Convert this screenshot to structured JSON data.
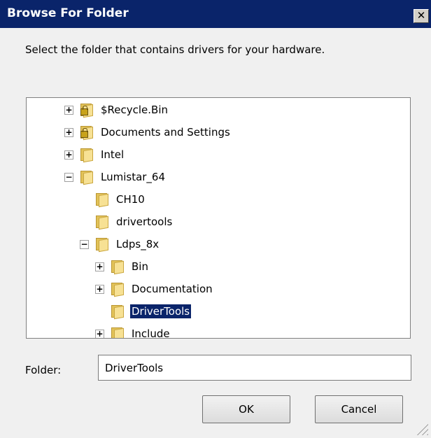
{
  "window": {
    "title": "Browse For Folder",
    "close_glyph": "✕"
  },
  "instruction": "Select the folder that contains drivers for your hardware.",
  "tree": {
    "items": [
      {
        "label": "$Recycle.Bin",
        "level": 0,
        "expander": "+",
        "icon": "locked-folder-icon"
      },
      {
        "label": "Documents and Settings",
        "level": 0,
        "expander": "+",
        "icon": "locked-folder-icon"
      },
      {
        "label": "Intel",
        "level": 0,
        "expander": "+",
        "icon": "folder-icon"
      },
      {
        "label": "Lumistar_64",
        "level": 0,
        "expander": "−",
        "icon": "folder-icon"
      },
      {
        "label": "CH10",
        "level": 1,
        "expander": "",
        "icon": "folder-icon"
      },
      {
        "label": "drivertools",
        "level": 1,
        "expander": "",
        "icon": "folder-icon"
      },
      {
        "label": "Ldps_8x",
        "level": 1,
        "expander": "−",
        "icon": "folder-icon"
      },
      {
        "label": "Bin",
        "level": 2,
        "expander": "+",
        "icon": "folder-icon"
      },
      {
        "label": "Documentation",
        "level": 2,
        "expander": "+",
        "icon": "folder-icon"
      },
      {
        "label": "DriverTools",
        "level": 2,
        "expander": "",
        "icon": "folder-icon",
        "selected": true
      },
      {
        "label": "Include",
        "level": 2,
        "expander": "+",
        "icon": "folder-icon"
      }
    ]
  },
  "folder": {
    "label": "Folder:",
    "value": "DriverTools"
  },
  "buttons": {
    "ok": "OK",
    "cancel": "Cancel"
  },
  "colors": {
    "titlebar": "#0a246a",
    "selection": "#0a246a",
    "dialog_bg": "#f0f0f0"
  }
}
